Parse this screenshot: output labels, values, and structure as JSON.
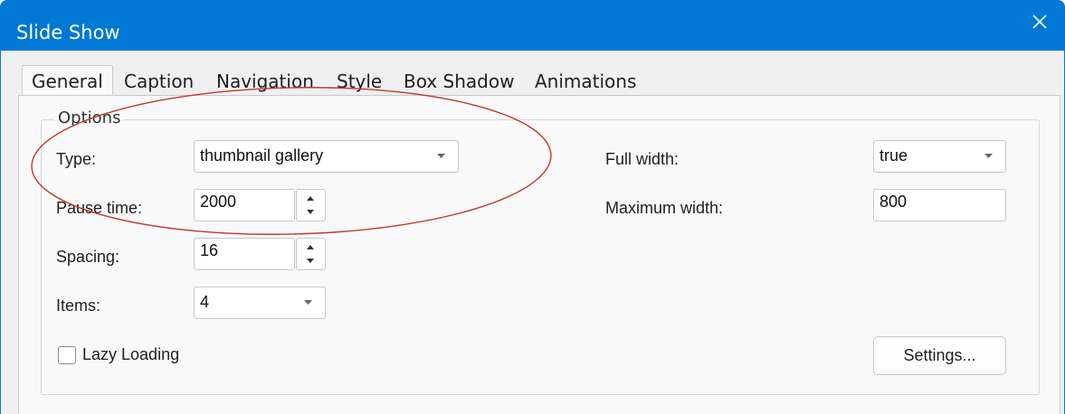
{
  "window": {
    "title": "Slide Show",
    "accent": "#0078d4"
  },
  "tabs": [
    {
      "label": "General",
      "active": true
    },
    {
      "label": "Caption"
    },
    {
      "label": "Navigation"
    },
    {
      "label": "Style"
    },
    {
      "label": "Box Shadow"
    },
    {
      "label": "Animations"
    }
  ],
  "options": {
    "group_title": "Options",
    "type": {
      "label": "Type:",
      "value": "thumbnail gallery"
    },
    "pause_time": {
      "label": "Pause time:",
      "value": "2000"
    },
    "spacing": {
      "label": "Spacing:",
      "value": "16"
    },
    "items": {
      "label": "Items:",
      "value": "4"
    },
    "lazy_loading": {
      "label": "Lazy Loading",
      "checked": false
    },
    "full_width": {
      "label": "Full width:",
      "value": "true"
    },
    "maximum_width": {
      "label": "Maximum width:",
      "value": "800"
    },
    "settings_button": {
      "label": "Settings..."
    }
  },
  "annotation": {
    "color": "#c0392b"
  }
}
